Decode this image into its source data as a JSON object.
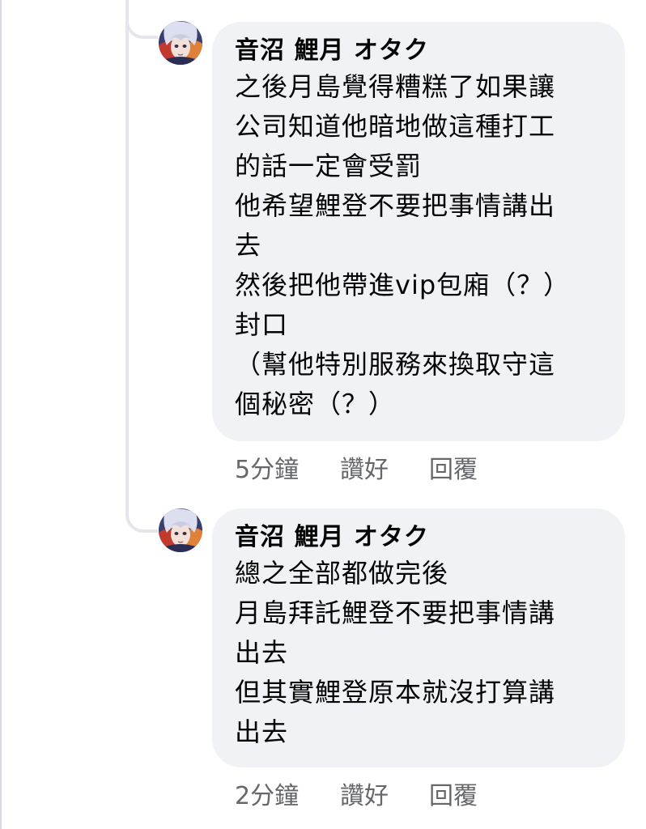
{
  "comments": [
    {
      "avatar_icon": "anime-avatar-icon",
      "author": "音沼 鯉月 オタク",
      "lines": [
        "之後月島覺得糟糕了如果讓",
        "公司知道他暗地做這種打工",
        "的話一定會受罰",
        "他希望鯉登不要把事情講出",
        "去",
        "然後把他帶進vip包廂（？）",
        "封口",
        "（幫他特別服務來換取守這",
        "個秘密（？）"
      ],
      "time": "5分鐘",
      "like_label": "讚好",
      "reply_label": "回覆"
    },
    {
      "avatar_icon": "anime-avatar-icon",
      "author": "音沼 鯉月 オタク",
      "lines": [
        "總之全部都做完後",
        "月島拜託鯉登不要把事情講",
        "出去",
        "但其實鯉登原本就沒打算講",
        "出去"
      ],
      "time": "2分鐘",
      "like_label": "讚好",
      "reply_label": "回覆"
    }
  ],
  "colors": {
    "bubble_bg": "#f0f2f5",
    "text": "#050505",
    "meta_text": "#65676b",
    "thread_line": "#e4e6eb"
  }
}
